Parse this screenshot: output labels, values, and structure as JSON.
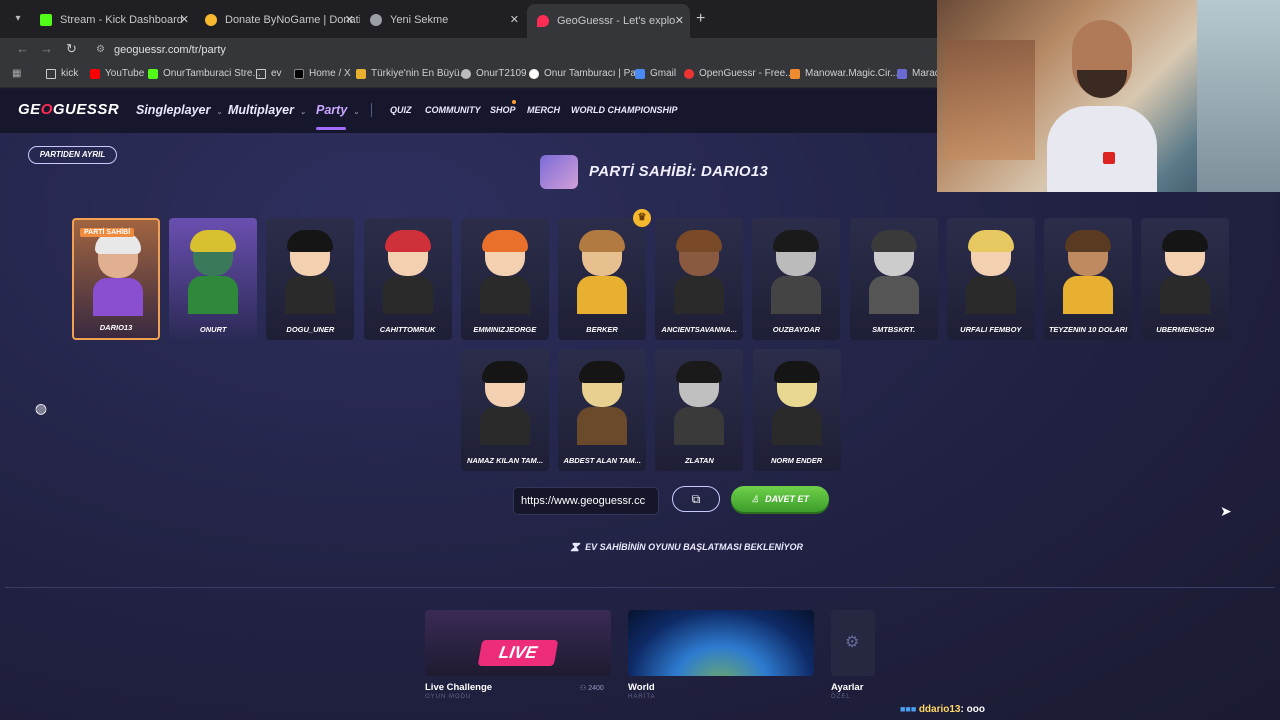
{
  "browser": {
    "tabs": [
      {
        "title": "Stream - Kick Dashboard",
        "favicon_color": "#53fc18"
      },
      {
        "title": "Donate ByNoGame | Donations",
        "favicon_color": "#f5b82e"
      },
      {
        "title": "Yeni Sekme",
        "favicon_color": "#9aa0a6"
      },
      {
        "title": "GeoGuessr - Let's explore the w",
        "favicon_color": "#ff2d55"
      }
    ],
    "new_tab": "+",
    "url": "geoguessr.com/tr/party",
    "bookmarks": [
      "kick",
      "YouTube",
      "OnurTamburaci Stre...",
      "ev",
      "Home / X",
      "Türkiye'nin En Büyü...",
      "OnurT2109",
      "Onur Tamburacı | Pa...",
      "Gmail",
      "OpenGuessr - Free...",
      "Manowar.Magic.Cir...",
      "Maradc"
    ]
  },
  "nav": {
    "logo_pre": "GE",
    "logo_o": "O",
    "logo_post": "GUESSR",
    "items": [
      "Singleplayer",
      "Multiplayer",
      "Party",
      "QUIZ",
      "COMMUNITY",
      "SHOP",
      "MERCH",
      "WORLD CHAMPIONSHIP"
    ],
    "caret": "⌄"
  },
  "party": {
    "leave_label": "PARTIDEN AYRIL",
    "host_title": "PARTİ SAHİBİ: DARIO13",
    "owner_tag": "PARTİ SAHİBİ",
    "crown": "♛",
    "players_row1": [
      "DARIO13",
      "ONURT",
      "DOGU_UNER",
      "CAHITTOMRUK",
      "EMMINIZJEORGE",
      "BERKER",
      "ANCIENTSAVANNA...",
      "OUZBAYDAR",
      "SMTBSKRT.",
      "URFALI FEMBOY",
      "TEYZENIN 10 DOLARI",
      "UBERMENSCH0"
    ],
    "players_row2": [
      "NAMAZ KILAN TAM...",
      "ABDEST ALAN TAM...",
      "ZLATAN",
      "NORM ENDER"
    ],
    "invite_url": "https://www.geoguessr.cc",
    "copy_icon": "⧉",
    "invite_label": "DAVET ET",
    "waiting_text": "EV SAHİBİNİN OYUNU BAŞLATMASI BEKLENİYOR",
    "hourglass": "⧗"
  },
  "modes": {
    "live_badge": "LIVE",
    "live_label": "Live Challenge",
    "live_sub": "OYUN MODU",
    "live_count": "2400",
    "world_label": "World",
    "world_sub": "HARİTA",
    "settings_label": "Ayarlar",
    "settings_sub": "ÖZEL"
  },
  "chat": {
    "user": "ddario13",
    "message": ": ooo"
  },
  "colors": {
    "accent": "#a56dff",
    "brand": "#ff2d55",
    "invite": "#4caf34"
  }
}
